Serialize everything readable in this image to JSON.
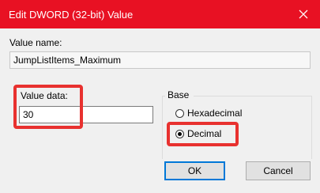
{
  "window": {
    "title": "Edit DWORD (32-bit) Value",
    "titlebar_color": "#e81123"
  },
  "value_name": {
    "label": "Value name:",
    "value": "JumpListItems_Maximum"
  },
  "value_data": {
    "label": "Value data:",
    "value": "30"
  },
  "base": {
    "label": "Base",
    "options": [
      {
        "label": "Hexadecimal",
        "selected": false
      },
      {
        "label": "Decimal",
        "selected": true
      }
    ]
  },
  "buttons": {
    "ok": "OK",
    "cancel": "Cancel"
  },
  "annotations": {
    "highlight_color": "#e8312f"
  },
  "icons": {
    "close": "close-icon"
  }
}
